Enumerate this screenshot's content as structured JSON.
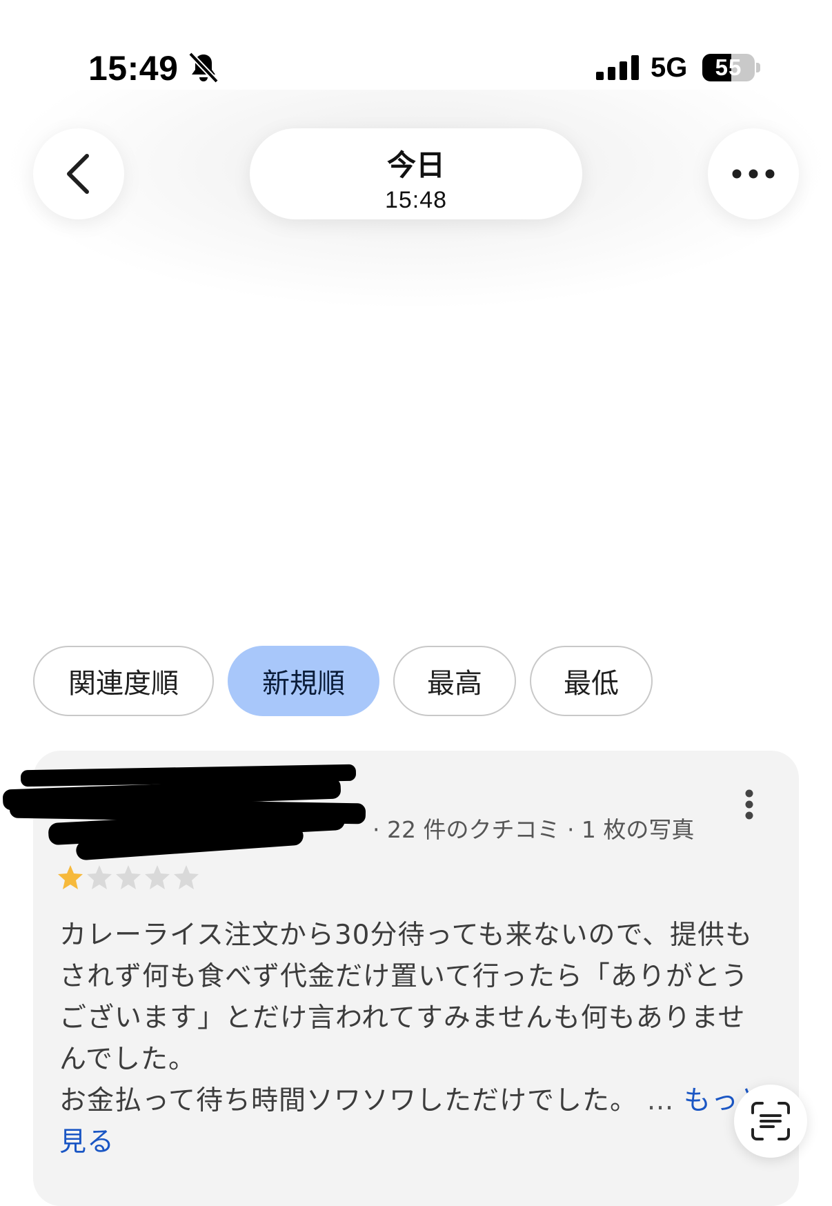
{
  "status_bar": {
    "time": "15:49",
    "network": "5G",
    "battery_percent": "55",
    "battery_level": 0.55,
    "icons": [
      "bell-off-icon",
      "signal-bars-icon"
    ]
  },
  "header": {
    "title": "今日",
    "subtitle": "15:48",
    "icons": [
      "chevron-left-icon",
      "more-horizontal-icon"
    ]
  },
  "sort_chips": [
    {
      "label": "関連度順",
      "active": false
    },
    {
      "label": "新規順",
      "active": true
    },
    {
      "label": "最高",
      "active": false
    },
    {
      "label": "最低",
      "active": false
    }
  ],
  "review": {
    "meta": "· 22 件のクチコミ · 1 枚の写真",
    "rating": 1,
    "max_rating": 5,
    "star_color": "#f6b93b",
    "star_empty_color": "#d9d9d9",
    "paragraph1": "カレーライス注文から30分待っても来ないので、提供もされず何も食べず代金だけ置いて行ったら「ありがとうございます」とだけ言われてすみませんも何もありませんでした。",
    "paragraph2": "お金払って待ち時間ソワソワしただけでした。",
    "ellipsis": " … ",
    "more_link": "もっと見る",
    "icons": [
      "more-vertical-icon",
      "text-scan-icon"
    ]
  },
  "colors": {
    "active_chip": "#a8c7fa",
    "link": "#1a56c4",
    "card_bg": "#f3f3f3"
  }
}
